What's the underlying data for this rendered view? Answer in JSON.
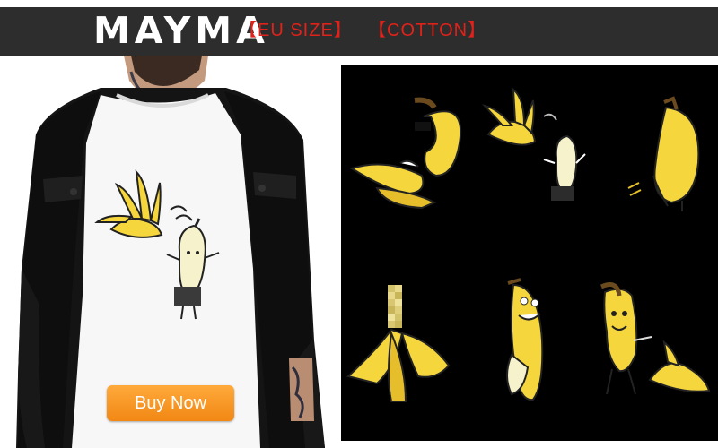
{
  "header": {
    "brand": "MAYMA",
    "tags": [
      "【EU SIZE】",
      "【COTTON】"
    ]
  },
  "product": {
    "buy_label": "Buy Now"
  },
  "colors": {
    "header_bg": "#2d2d2d",
    "tag_red": "#e0221a",
    "button_orange": "#f5921e",
    "banana_yellow": "#f5d63d",
    "panel_bg": "#000000"
  },
  "icons": [
    "banana-icon",
    "peeled-banana-icon",
    "pixelated-banana-icon"
  ]
}
